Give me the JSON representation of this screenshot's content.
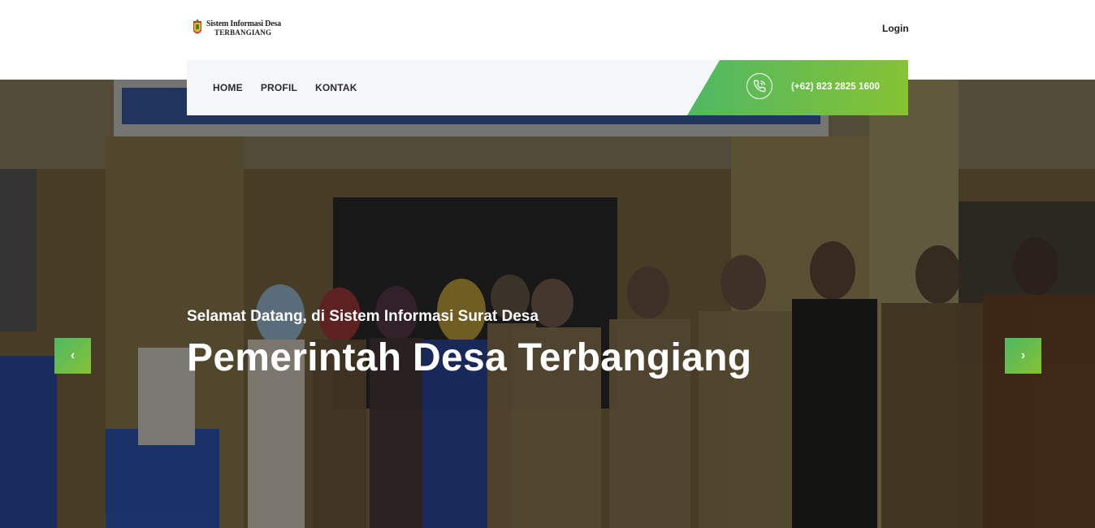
{
  "header": {
    "logo_line1": "Sistem Informasi Desa",
    "logo_line2": "TERBANGIANG",
    "login_label": "Login"
  },
  "nav": {
    "items": [
      {
        "label": "HOME"
      },
      {
        "label": "PROFIL"
      },
      {
        "label": "KONTAK"
      }
    ],
    "phone": "(+62) 823 2825 1600",
    "phone_icon": "phone-call-icon"
  },
  "hero": {
    "subtitle": "Selamat Datang, di Sistem Informasi Surat Desa",
    "title": "Pemerintah Desa Terbangiang",
    "prev_icon": "chevron-left-icon",
    "next_icon": "chevron-right-icon"
  },
  "colors": {
    "accent_start": "#4fb864",
    "accent_end": "#86c233",
    "nav_bg": "#f4f6fa"
  }
}
